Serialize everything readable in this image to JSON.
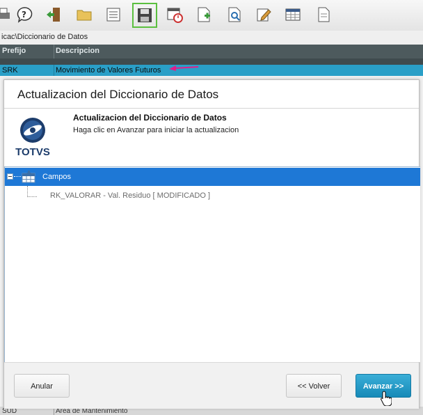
{
  "toolbar": {
    "icons": [
      "printer-icon",
      "help-icon",
      "exit-icon",
      "folder-icon",
      "notes-icon",
      "save-icon",
      "calendar-check-icon",
      "add-document-icon",
      "preview-icon",
      "edit-icon",
      "table-icon",
      "document-icon"
    ],
    "active_icon": "save-icon",
    "active_color": "#5bbf3f"
  },
  "path": {
    "text": "icac\\Diccionario de Datos"
  },
  "grid": {
    "headers": [
      "Prefijo",
      "Descripcion"
    ],
    "selected_row": {
      "prefix": "SRK",
      "description": "Movimiento de Valores Futuros"
    },
    "bottom_row": {
      "prefix": "SUD",
      "description": "Area de Mantenimiento"
    },
    "header_color": "#4d5a5d",
    "selected_color": "#2a9fc7"
  },
  "dialog": {
    "title": "Actualizacion del Diccionario de Datos",
    "logo_text": "TOTVS",
    "header": {
      "title": "Actualizacion del Diccionario de Datos",
      "subtitle": "Haga clic en Avanzar para iniciar la actualizacion"
    },
    "tree": {
      "root_label": "Campos",
      "child_label": "RK_VALORAR - Val. Residuo  [ MODIFICADO ]"
    },
    "buttons": {
      "cancel": "Anular",
      "back": "<< Volver",
      "next": "Avanzar >>"
    },
    "accent_color": "#1e78d6"
  }
}
